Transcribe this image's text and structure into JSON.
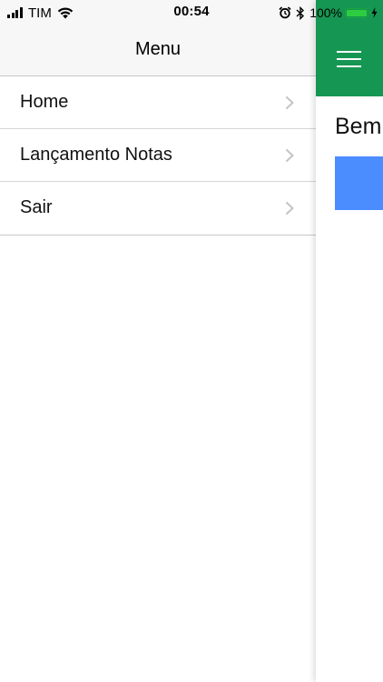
{
  "status_bar": {
    "carrier": "TIM",
    "time": "00:54",
    "battery_percent": "100%",
    "battery_color": "#2ecc40",
    "icons": [
      "cellular-signal-icon",
      "wifi-icon",
      "alarm-icon",
      "bluetooth-icon",
      "battery-icon",
      "charging-bolt-icon"
    ]
  },
  "menu": {
    "title": "Menu",
    "items": [
      {
        "label": "Home"
      },
      {
        "label": "Lançamento Notas"
      },
      {
        "label": "Sair"
      }
    ]
  },
  "main": {
    "app_bar_color": "#169653",
    "welcome_text": "Bem",
    "accent_block_color": "#4b8dff"
  }
}
